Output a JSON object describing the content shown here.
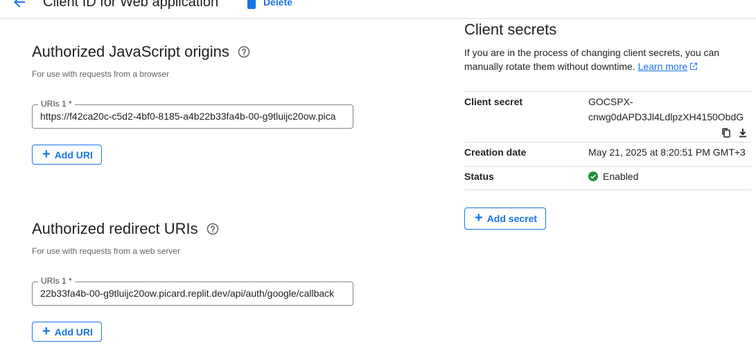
{
  "header": {
    "title": "Client ID for Web application",
    "delete_label": "Delete"
  },
  "js_origins": {
    "title": "Authorized JavaScript origins",
    "subtitle": "For use with requests from a browser",
    "field_label": "URIs 1 *",
    "field_value": "https://f42ca20c-c5d2-4bf0-8185-a4b22b33fa4b-00-g9tluijc20ow.pica",
    "add_label": "Add URI"
  },
  "redirect_uris": {
    "title": "Authorized redirect URIs",
    "subtitle": "For use with requests from a web server",
    "field_label": "URIs 1 *",
    "field_value": "22b33fa4b-00-g9tluijc20ow.picard.replit.dev/api/auth/google/callback",
    "add_label": "Add URI"
  },
  "client_secrets": {
    "title": "Client secrets",
    "description": "If you are in the process of changing client secrets, you can manually rotate them without downtime.",
    "learn_more": "Learn more",
    "secret_label": "Client secret",
    "secret_value_line1": "GOCSPX-",
    "secret_value_line2": "cnwg0dAPD3Jl4LdlpzXH4150ObdG",
    "creation_label": "Creation date",
    "creation_value": "May 21, 2025 at 8:20:51 PM GMT+3",
    "status_label": "Status",
    "status_value": "Enabled",
    "add_secret_label": "Add secret"
  },
  "icons": [
    "back-arrow-icon",
    "trash-icon",
    "help-icon",
    "plus-icon",
    "external-link-icon",
    "copy-icon",
    "download-icon",
    "check-circle-icon"
  ],
  "colors": {
    "accent": "#1a73e8",
    "success": "#1e8e3e",
    "divider": "#dadce0",
    "text": "#202124",
    "muted": "#5f6368"
  }
}
